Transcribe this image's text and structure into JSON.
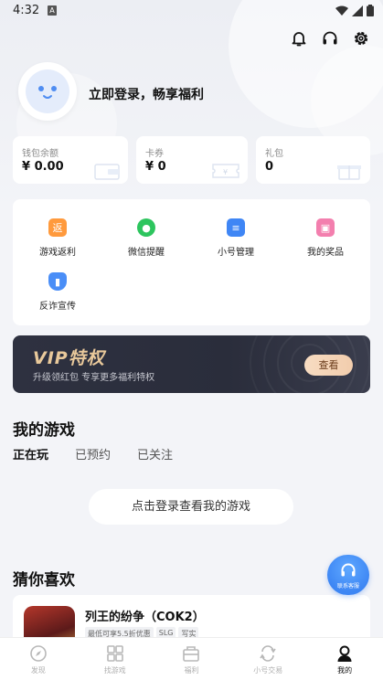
{
  "status_bar": {
    "time": "4:32",
    "notif_letter": "A"
  },
  "header": {
    "icons": [
      "bell-icon",
      "headset-icon",
      "settings-icon"
    ]
  },
  "profile": {
    "login_prompt": "立即登录，畅享福利"
  },
  "wallet": [
    {
      "label": "钱包余额",
      "value": "¥ 0.00"
    },
    {
      "label": "卡券",
      "value": "¥ 0"
    },
    {
      "label": "礼包",
      "value": "0"
    }
  ],
  "services": [
    {
      "label": "游戏返利",
      "icon": "rebate-icon",
      "glyph": "返",
      "color": "#ff9a3d"
    },
    {
      "label": "微信提醒",
      "icon": "wechat-icon",
      "glyph": "●",
      "color": "#2dc55e"
    },
    {
      "label": "小号管理",
      "icon": "account-icon",
      "glyph": "≡",
      "color": "#3f86f5"
    },
    {
      "label": "我的奖品",
      "icon": "gift-icon",
      "glyph": "▣",
      "color": "#f37fae"
    },
    {
      "label": "反诈宣传",
      "icon": "shield-icon",
      "glyph": "▮",
      "color": "#4a8ef7"
    }
  ],
  "vip": {
    "title": "VIP特权",
    "subtitle": "升级领红包 专享更多福利特权",
    "button": "查看"
  },
  "my_games": {
    "title": "我的游戏",
    "tabs": [
      "正在玩",
      "已预约",
      "已关注"
    ],
    "login_button": "点击登录查看我的游戏"
  },
  "recommend": {
    "title": "猜你喜欢",
    "game": {
      "name": "列王的纷争（COK2）",
      "tags": [
        "最低可享5.5折优惠",
        "SLG",
        "写实"
      ]
    }
  },
  "customer_service": {
    "label": "联系客服"
  },
  "bottom_nav": [
    {
      "label": "发现",
      "icon": "compass-icon"
    },
    {
      "label": "找游戏",
      "icon": "grid-icon"
    },
    {
      "label": "福利",
      "icon": "gift-box-icon"
    },
    {
      "label": "小号交易",
      "icon": "exchange-icon"
    },
    {
      "label": "我的",
      "icon": "user-icon"
    }
  ],
  "colors": {
    "accent": "#3d86f4",
    "vip_gold": "#e9c99b",
    "background": "#f3f4f8"
  }
}
